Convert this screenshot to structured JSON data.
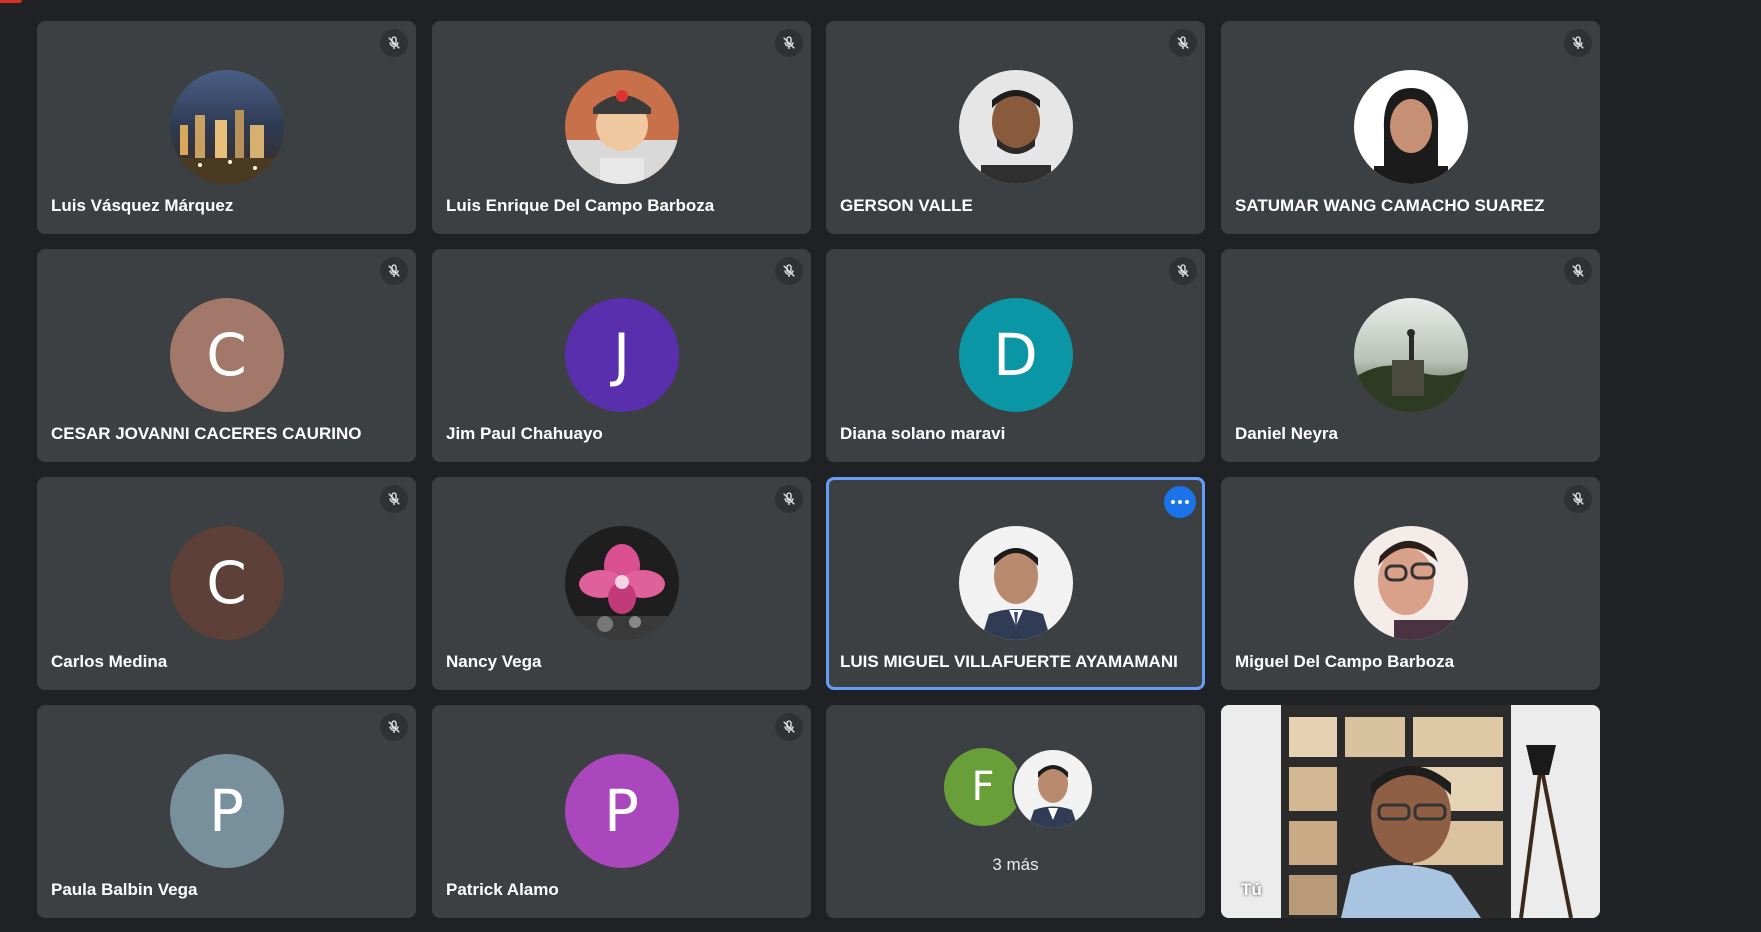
{
  "participants": [
    {
      "name": "Luis Vásquez Márquez",
      "muted": true,
      "avatar": {
        "kind": "photo",
        "desc": "city-night"
      }
    },
    {
      "name": "Luis Enrique Del Campo Barboza",
      "muted": true,
      "avatar": {
        "kind": "photo",
        "desc": "child-cap"
      }
    },
    {
      "name": "GERSON VALLE",
      "muted": true,
      "avatar": {
        "kind": "photo",
        "desc": "man-portrait"
      }
    },
    {
      "name": "SATUMAR WANG CAMACHO SUAREZ",
      "muted": true,
      "avatar": {
        "kind": "photo",
        "desc": "woman-portrait"
      }
    },
    {
      "name": "CESAR JOVANNI CACERES CAURINO",
      "muted": true,
      "avatar": {
        "kind": "initial",
        "letter": "C",
        "color": "#a1786a"
      }
    },
    {
      "name": "Jim Paul Chahuayo",
      "muted": true,
      "avatar": {
        "kind": "initial",
        "letter": "J",
        "color": "#5a2fae"
      }
    },
    {
      "name": "Diana solano maravi",
      "muted": true,
      "avatar": {
        "kind": "initial",
        "letter": "D",
        "color": "#0b96a5"
      }
    },
    {
      "name": "Daniel Neyra",
      "muted": true,
      "avatar": {
        "kind": "photo",
        "desc": "mountain"
      }
    },
    {
      "name": "Carlos Medina",
      "muted": true,
      "avatar": {
        "kind": "initial",
        "letter": "C",
        "color": "#5d4037"
      }
    },
    {
      "name": "Nancy Vega",
      "muted": true,
      "avatar": {
        "kind": "photo",
        "desc": "orchid"
      }
    },
    {
      "name": "LUIS MIGUEL VILLAFUERTE AYAMAMANI",
      "muted": false,
      "active": true,
      "avatar": {
        "kind": "photo",
        "desc": "man-suit"
      }
    },
    {
      "name": "Miguel Del Campo Barboza",
      "muted": true,
      "avatar": {
        "kind": "photo",
        "desc": "boy-glasses"
      }
    },
    {
      "name": "Paula Balbin Vega",
      "muted": true,
      "avatar": {
        "kind": "initial",
        "letter": "P",
        "color": "#78909c"
      }
    },
    {
      "name": "Patrick Alamo",
      "muted": true,
      "avatar": {
        "kind": "initial",
        "letter": "P",
        "color": "#aa47bc"
      }
    }
  ],
  "more_tile": {
    "label": "3 más",
    "initial": "F",
    "initial_color": "#689f38"
  },
  "self_tile": {
    "label": "Tú"
  },
  "icons": {
    "mute": "mic-off-icon",
    "options": "more-options-icon"
  }
}
